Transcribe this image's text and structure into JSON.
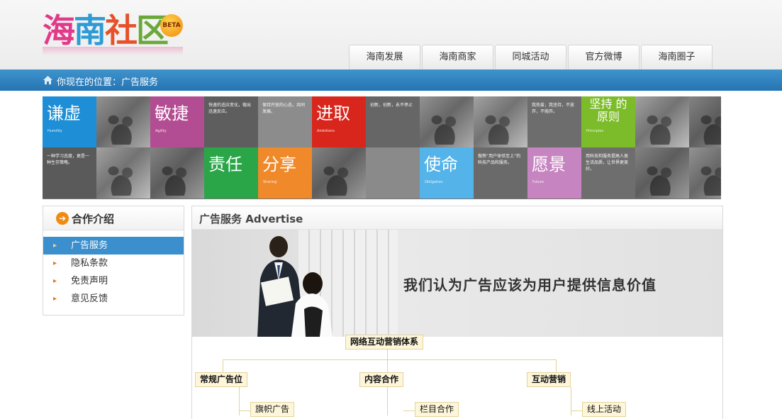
{
  "header": {
    "logo": {
      "text_chars": [
        "海",
        "南",
        "社",
        "区"
      ],
      "badge": "BETA"
    },
    "nav": [
      "海南发展",
      "海南商家",
      "同城活动",
      "官方微博",
      "海南圈子"
    ]
  },
  "breadcrumb": {
    "prefix": "你现在的位置：广告服务"
  },
  "banner": {
    "tiles": [
      {
        "text": "谦虚",
        "en": "Humility",
        "color": "#1e8fd6"
      },
      {
        "text": "敏捷",
        "en": "Agility",
        "color": "#b34d93"
      },
      {
        "text": "进取",
        "en": "Ambitions",
        "color": "#d9261c"
      },
      {
        "text": "坚持 的 原则",
        "en": "Principles",
        "color": "#7cbc2a"
      },
      {
        "text": "责任",
        "en": "",
        "color": "#2aa649"
      },
      {
        "text": "分享",
        "en": "Sharing",
        "color": "#f0892a"
      },
      {
        "text": "使命",
        "en": "Obligation",
        "color": "#54b3e8"
      },
      {
        "text": "愿景",
        "en": "Future",
        "color": "#c685c0"
      }
    ],
    "captions": [
      "快速的适应变化，做出迅速反应。",
      "保持开放的心态，共同发展。",
      "创新，创新，永不停止",
      "我热爱，我坚持，不放弃，不抛弃。",
      "一种学习态度，更是一种生存策略。",
      "做熟“用户体验至上”的科技产品和服务。",
      "用科技和服务提高人类生活品质，让世界更美好。"
    ]
  },
  "sidebar": {
    "title": "合作介绍",
    "items": [
      {
        "label": "广告服务",
        "active": true
      },
      {
        "label": "隐私条款",
        "active": false
      },
      {
        "label": "免责声明",
        "active": false
      },
      {
        "label": "意见反馈",
        "active": false
      }
    ]
  },
  "main": {
    "title": "广告服务 Advertise",
    "slogan": "我们认为广告应该为用户提供信息价值",
    "chart": {
      "root": "网络互动营销体系",
      "branches": [
        "常规广告位",
        "内容合作",
        "互动营销"
      ],
      "subs": [
        "旗帜广告",
        "栏目合作",
        "线上活动"
      ]
    }
  },
  "colors": {
    "accent": "#2f86c6",
    "bullet": "#e07a10",
    "node_bg": "#fdf6da"
  }
}
